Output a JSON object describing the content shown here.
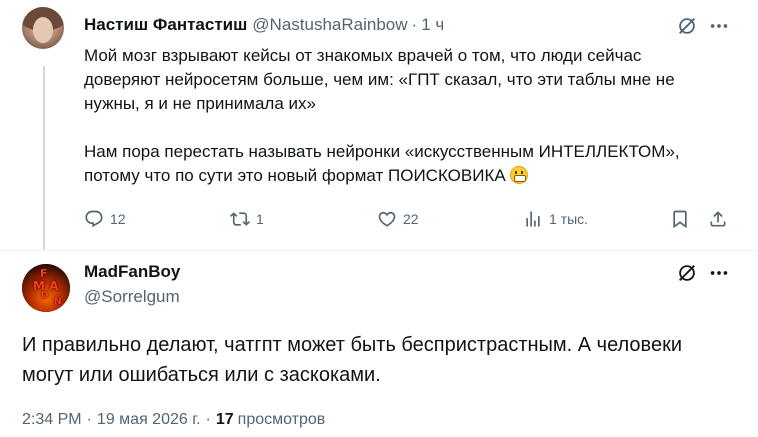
{
  "tweet": {
    "author_name": "Настиш Фантастиш",
    "author_handle": "@NastushaRainbow",
    "separator": "·",
    "time": "1 ч",
    "text_lines": [
      "Мой мозг взрывают кейсы от знакомых врачей о том, что люди сейчас",
      "доверяют нейросетям больше, чем им: «ГПТ сказал, что эти таблы мне не",
      "нужны, я и не принимала их»",
      "Нам пора перестать называть нейронки «искусственным ИНТЕЛЛЕКТОМ»,",
      "потому что по сути это новый формат ПОИСКОВИКА"
    ],
    "emoji": "grimacing-face",
    "stats": {
      "replies": "12",
      "reposts": "1",
      "likes": "22",
      "views": "1 тыс."
    }
  },
  "reply": {
    "author_name": "MadFanBoy",
    "author_handle": "@Sorrelgum",
    "avatar_text": [
      "F",
      "M A",
      "D",
      "N"
    ],
    "text_lines": [
      "И правильно делают, чатгпт может быть беспристрастным. А человеки",
      "могут или ошибаться или с заскоками."
    ],
    "meta": {
      "time": "2:34 PM",
      "date": "19 мая 2026 г.",
      "separator": "·",
      "views_count": "17",
      "views_label": "просмотров"
    }
  },
  "colors": {
    "text": "#0f1419",
    "secondary": "#536471",
    "divider": "#eff3f4",
    "thread_line": "#cfd9de"
  },
  "icons": [
    "grok-icon",
    "more-icon",
    "reply-icon",
    "repost-icon",
    "like-icon",
    "views-icon",
    "bookmark-icon",
    "share-icon"
  ]
}
